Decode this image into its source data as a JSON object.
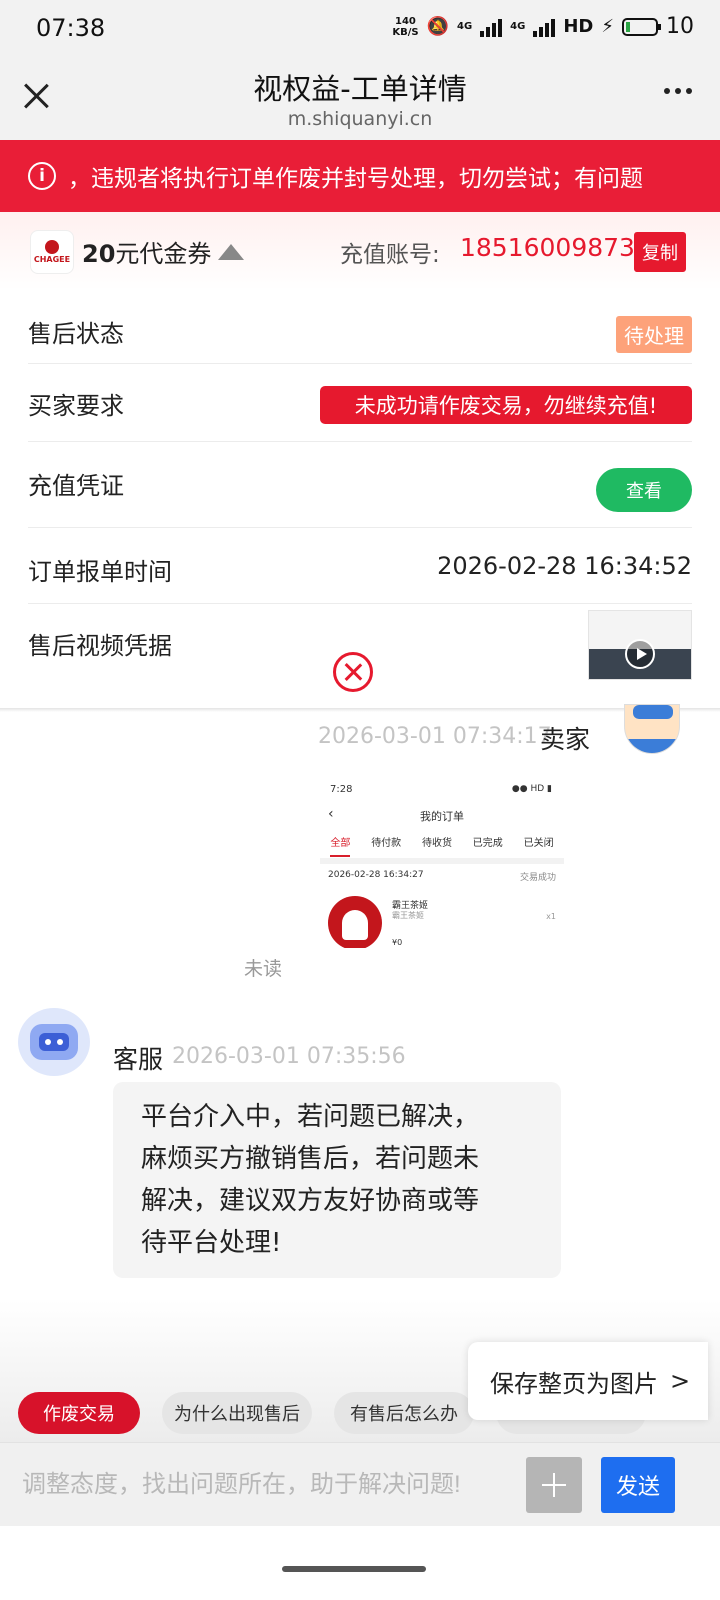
{
  "status_bar": {
    "time": "07:38",
    "net_speed_value": "140",
    "net_speed_unit": "KB/S",
    "network_1": "4G",
    "network_2": "4G",
    "hd_label": "HD",
    "battery_level": "10"
  },
  "title_bar": {
    "title": "视权益-工单详情",
    "url": "m.shiquanyi.cn"
  },
  "warning": {
    "icon": "info-icon",
    "text": "，违规者将执行订单作废并封号处理，切勿尝试；有问题"
  },
  "product": {
    "brand_logo_text": "CHAGEE",
    "amount": "20",
    "name_suffix": "元代金券",
    "account_label": "充值账号:",
    "account_number": "18516009873",
    "copy_label": "复制"
  },
  "details": {
    "after_sale_status": {
      "label": "售后状态",
      "value": "待处理"
    },
    "buyer_request": {
      "label": "买家要求",
      "value": "未成功请作废交易，勿继续充值!"
    },
    "recharge_proof": {
      "label": "充值凭证",
      "button": "查看"
    },
    "order_time": {
      "label": "订单报单时间",
      "value": "2026-02-28 16:34:52"
    },
    "video_proof": {
      "label": "售后视频凭据"
    }
  },
  "chat": {
    "seller_message": {
      "time": "2026-03-01 07:34:17",
      "sender": "卖家",
      "read_status": "未读",
      "screenshot": {
        "time": "7:28",
        "title": "我的订单",
        "tabs": [
          "全部",
          "待付款",
          "待收货",
          "已完成",
          "已关闭"
        ],
        "active_tab": "全部",
        "order_date": "2026-02-28 16:34:27",
        "order_status": "交易成功",
        "product_name": "霸王茶姬",
        "product_sub": "霸王茶姬",
        "quantity": "x1",
        "price": "¥0"
      }
    },
    "cs_message": {
      "sender": "客服",
      "time": "2026-03-01 07:35:56",
      "lines": [
        "平台介入中，若问题已解决，",
        "麻烦买方撤销售后，若问题未",
        "解决，建议双方友好协商或等",
        "待平台处理!"
      ]
    }
  },
  "save_page": {
    "label": "保存整页为图片",
    "arrow": ">"
  },
  "quick_replies": [
    "作废交易",
    "为什么出现售后",
    "有售后怎么办"
  ],
  "input_bar": {
    "placeholder": "调整态度，找出问题所在，助于解决问题!",
    "send_label": "发送"
  },
  "colors": {
    "primary_red": "#e6192e",
    "pending_orange": "#fda27a",
    "view_green": "#1fba62",
    "send_blue": "#1e6ef0"
  }
}
